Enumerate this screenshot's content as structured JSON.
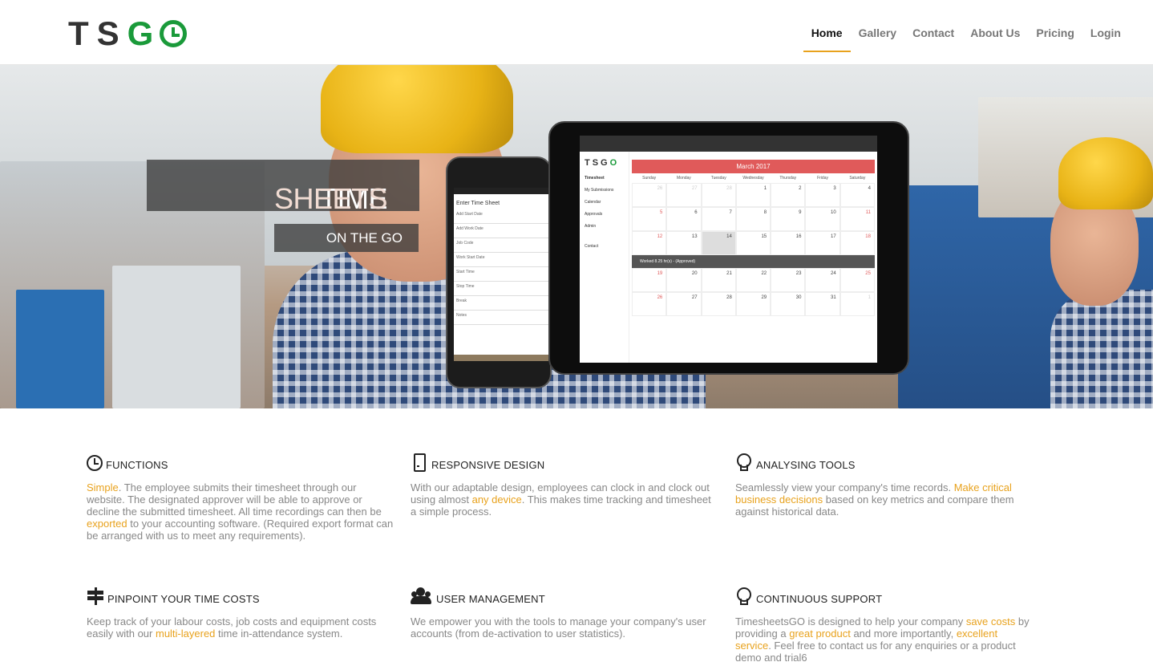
{
  "brand": {
    "logo_dark": "TS",
    "logo_green": "G"
  },
  "nav": {
    "items": [
      {
        "label": "Home",
        "active": true
      },
      {
        "label": "Gallery"
      },
      {
        "label": "Contact"
      },
      {
        "label": "About Us"
      },
      {
        "label": "Pricing"
      },
      {
        "label": "Login"
      }
    ]
  },
  "hero": {
    "title_part1": "TIME",
    "title_part2": "SHEETS",
    "subtitle": "ON THE GO"
  },
  "mockup": {
    "phone_title": "Enter Time Sheet",
    "phone_rows": [
      "Add Start Date",
      "Add Work Date",
      "Job Code",
      "Work Start Date",
      "Start Time",
      "Stop Time",
      "Break",
      "Notes"
    ],
    "tablet_logo_dark": "TSG",
    "tablet_logo_green": "O",
    "tablet_menu": [
      "Timesheet",
      "My Submissions",
      "Calendar",
      "Approvals",
      "Admin",
      "Contact"
    ],
    "calendar_month": "March 2017",
    "weekdays": [
      "Sunday",
      "Monday",
      "Tuesday",
      "Wednesday",
      "Thursday",
      "Friday",
      "Saturday"
    ],
    "week1": [
      "26",
      "27",
      "28",
      "1",
      "2",
      "3",
      "4"
    ],
    "week2": [
      "5",
      "6",
      "7",
      "8",
      "9",
      "10",
      "11"
    ],
    "week3": [
      "12",
      "13",
      "14",
      "15",
      "16",
      "17",
      "18"
    ],
    "worked_bar": "Worked 8.25 hr(s) - (Approved)",
    "week4": [
      "19",
      "20",
      "21",
      "22",
      "23",
      "24",
      "25"
    ],
    "week5": [
      "26",
      "27",
      "28",
      "29",
      "30",
      "31",
      "1"
    ]
  },
  "features": [
    {
      "icon": "clock-icon",
      "title": "FUNCTIONS",
      "text_hl1": "Simple",
      "text_a": ". The employee submits their timesheet through our website. The designated approver will be able to approve or decline the submitted timesheet. All time recordings can then be ",
      "text_hl2": "exported",
      "text_b": " to your accounting software. (Required export format can be arranged with us to meet any requirements)."
    },
    {
      "icon": "mobile-icon",
      "title": "RESPONSIVE DESIGN",
      "text_a": "With our adaptable design, employees can clock in and clock out using almost ",
      "text_hl1": "any device",
      "text_b": ". This makes time tracking and timesheet a simple process."
    },
    {
      "icon": "lightbulb-icon",
      "title": "ANALYSING TOOLS",
      "text_a": "Seamlessly view your company's time records. ",
      "text_hl1": "Make critical business decisions",
      "text_b": " based on key metrics and compare them against historical data."
    },
    {
      "icon": "signpost-icon",
      "title": "PINPOINT YOUR TIME COSTS",
      "text_a": "Keep track of your labour costs, job costs and equipment costs easily with our ",
      "text_hl1": "multi-layered",
      "text_b": " time in-attendance system."
    },
    {
      "icon": "users-icon",
      "title": "USER MANAGEMENT",
      "text_a": "We empower you with the tools to manage your company's user accounts (from de-activation to user statistics)."
    },
    {
      "icon": "lightbulb-icon",
      "title": "CONTINUOUS SUPPORT",
      "text_a": "TimesheetsGO is designed to help your company ",
      "text_hl1": "save costs",
      "text_b": " by providing a ",
      "text_hl2": "great product",
      "text_c": " and more importantly, ",
      "text_hl3": "excellent service",
      "text_d": ". Feel free to contact us for any enquiries or a product demo and trial6"
    }
  ],
  "colors": {
    "accent": "#e8a21d",
    "brand_green": "#1a9a3a",
    "calendar_red": "#e05a5a"
  }
}
